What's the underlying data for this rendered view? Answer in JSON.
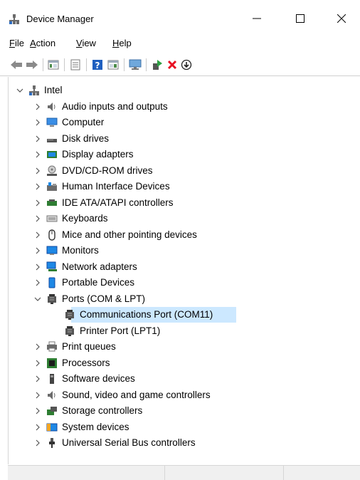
{
  "window": {
    "title": "Device Manager",
    "minimize_glyph": "—",
    "maximize_glyph": "☐",
    "close_glyph": "✕"
  },
  "menu": [
    {
      "label": "File",
      "accel": "F",
      "rest": "ile"
    },
    {
      "label": "Action",
      "accel": "A",
      "rest": "ction"
    },
    {
      "label": "View",
      "accel": "V",
      "rest": "iew"
    },
    {
      "label": "Help",
      "accel": "H",
      "rest": "elp"
    }
  ],
  "toolbar_icons": [
    "back-arrow-icon",
    "forward-arrow-icon",
    "show-hide-console-tree-icon",
    "properties-icon",
    "help-icon",
    "action-pane-icon",
    "scan-hardware-icon",
    "update-driver-icon",
    "uninstall-device-icon",
    "disable-device-icon"
  ],
  "tree": {
    "root": "Intel",
    "categories": [
      {
        "label": "Audio inputs and outputs",
        "icon": "speaker-icon"
      },
      {
        "label": "Computer",
        "icon": "computer-icon"
      },
      {
        "label": "Disk drives",
        "icon": "disk-drive-icon"
      },
      {
        "label": "Display adapters",
        "icon": "display-adapter-icon"
      },
      {
        "label": "DVD/CD-ROM drives",
        "icon": "dvd-drive-icon"
      },
      {
        "label": "Human Interface Devices",
        "icon": "hid-icon"
      },
      {
        "label": "IDE ATA/ATAPI controllers",
        "icon": "ide-controller-icon"
      },
      {
        "label": "Keyboards",
        "icon": "keyboard-icon"
      },
      {
        "label": "Mice and other pointing devices",
        "icon": "mouse-icon"
      },
      {
        "label": "Monitors",
        "icon": "monitor-icon"
      },
      {
        "label": "Network adapters",
        "icon": "network-adapter-icon"
      },
      {
        "label": "Portable Devices",
        "icon": "portable-device-icon"
      },
      {
        "label": "Ports (COM & LPT)",
        "icon": "port-icon",
        "expanded": true,
        "children": [
          {
            "label": "Communications Port (COM11)",
            "icon": "port-icon",
            "selected": true
          },
          {
            "label": "Printer Port (LPT1)",
            "icon": "port-icon"
          }
        ]
      },
      {
        "label": "Print queues",
        "icon": "printer-icon"
      },
      {
        "label": "Processors",
        "icon": "processor-icon"
      },
      {
        "label": "Software devices",
        "icon": "software-device-icon"
      },
      {
        "label": "Sound, video and game controllers",
        "icon": "speaker-icon"
      },
      {
        "label": "Storage controllers",
        "icon": "storage-controller-icon"
      },
      {
        "label": "System devices",
        "icon": "system-devices-icon"
      },
      {
        "label": "Universal Serial Bus controllers",
        "icon": "usb-icon"
      }
    ]
  },
  "colors": {
    "selection": "#cce8ff",
    "uninstall_red": "#e81123",
    "help_blue": "#1f5fbf"
  }
}
